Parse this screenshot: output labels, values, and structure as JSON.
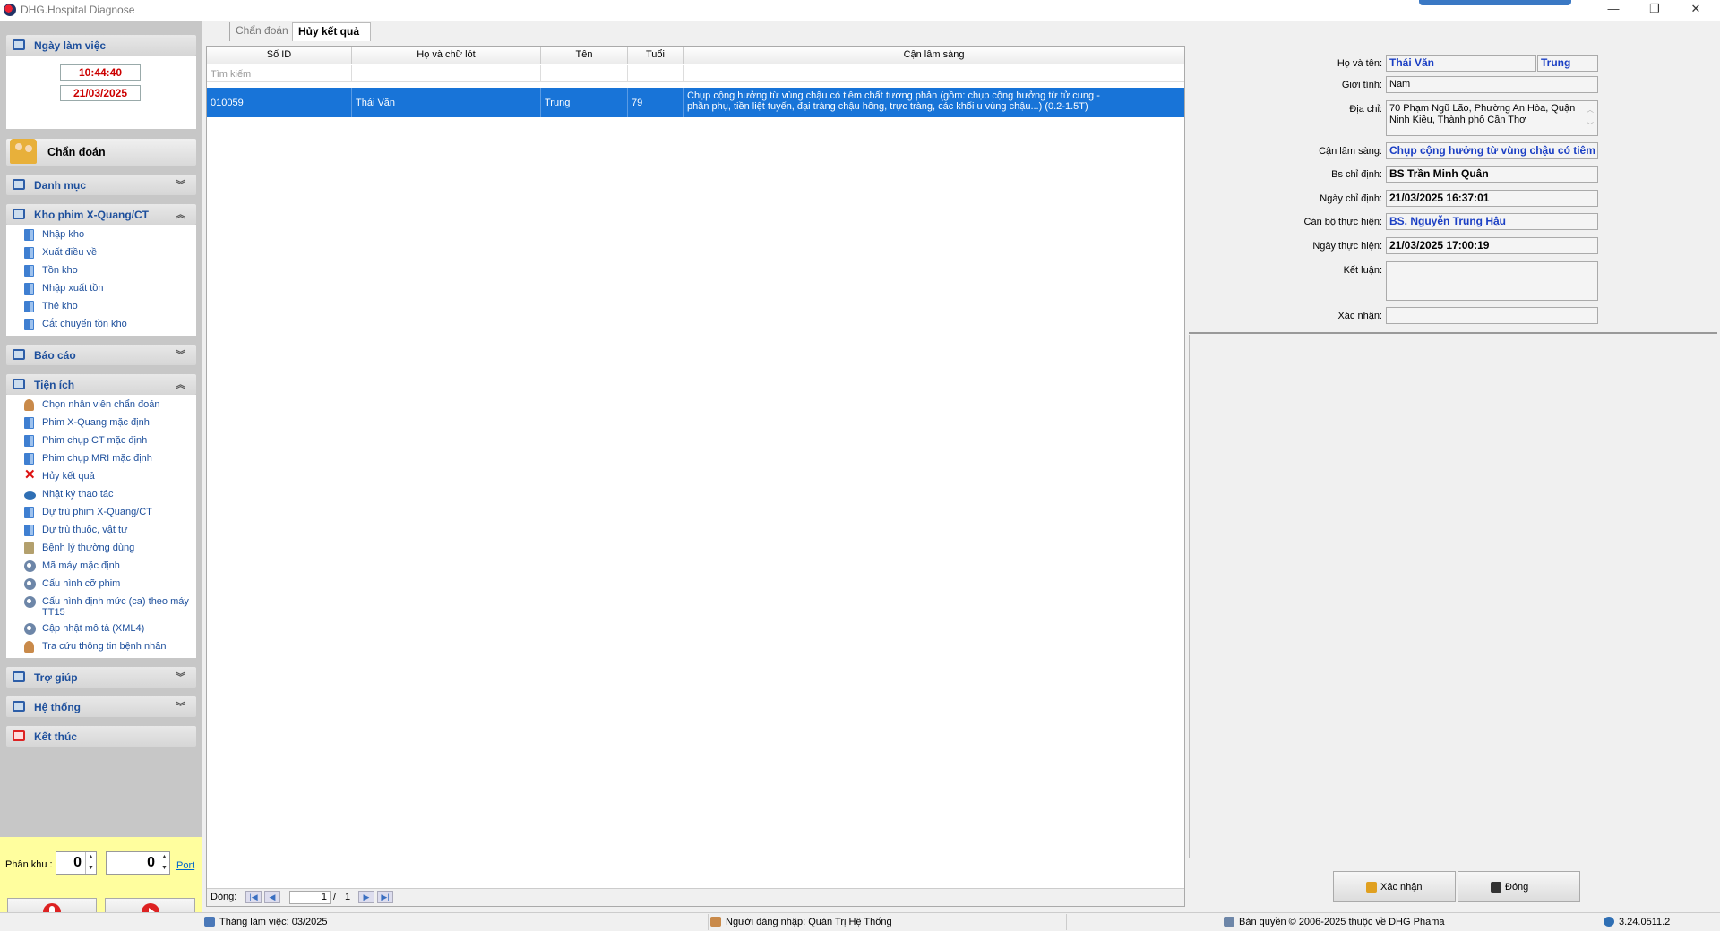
{
  "window": {
    "title": "DHG.Hospital Diagnose"
  },
  "sidebar": {
    "workday_header": "Ngày làm việc",
    "time": "10:44:40",
    "date": "21/03/2025",
    "chandoan_label": "Chẩn đoán",
    "danhmuc_header": "Danh mục",
    "kho_header": "Kho phim X-Quang/CT",
    "kho_items": [
      "Nhập kho",
      "Xuất điều về",
      "Tồn kho",
      "Nhập xuất tồn",
      "Thẻ kho",
      "Cắt chuyển tồn kho"
    ],
    "baocao_header": "Báo cáo",
    "tienich_header": "Tiện ích",
    "tienich_items": [
      "Chọn nhân viên chẩn đoán",
      "Phim X-Quang mặc định",
      "Phim chụp CT mặc định",
      "Phim chụp MRI mặc định",
      "Hủy kết quả",
      "Nhật ký thao tác",
      "Dự trù phim X-Quang/CT",
      "Dự trù thuốc, vật tư",
      "Bệnh lý thường dùng",
      "Mã máy mặc định",
      "Cấu hình cỡ phim",
      "Cấu hình định mức (ca) theo máy TT15",
      "Cập nhật mô tả (XML4)",
      "Tra cứu thông tin bệnh nhân"
    ],
    "trogiup_header": "Trợ giúp",
    "hethong_header": "Hệ thống",
    "ketthuc_header": "Kết thúc",
    "phankhu_label": "Phân khu :",
    "phankhu_value": "0",
    "port_value": "0",
    "port_label": "Port"
  },
  "tabs": {
    "inactive": "Chẩn đoán",
    "active": "Hủy kết quả"
  },
  "grid": {
    "columns": [
      "Số ID",
      "Họ và chữ lót",
      "Tên",
      "Tuổi",
      "Cận lâm sàng"
    ],
    "search_placeholder": "Tìm kiếm",
    "rows": [
      {
        "id": "010059",
        "ho": "Thái Văn",
        "ten": "Trung",
        "tuoi": "79",
        "cls": "Chụp cộng hưởng từ vùng chậu có tiêm chất tương phản (gồm: chụp cộng hưởng từ tử cung - phần phụ, tiền liệt tuyến, đại tràng chậu hông, trực tràng, các khối u vùng chậu...) (0.2-1.5T)"
      }
    ],
    "footer_label": "Dòng:",
    "page_current": "1",
    "page_sep": "/",
    "page_total": "1"
  },
  "detail": {
    "hoten_label": "Họ và tên:",
    "ho_value": "Thái Văn",
    "ten_value": "Trung",
    "gioitinh_label": "Giới tính:",
    "gioitinh_value": "Nam",
    "diachi_label": "Địa chỉ:",
    "diachi_value": "70 Phạm Ngũ Lão, Phường An Hòa, Quận Ninh Kiều, Thành phố Cần Thơ",
    "cls_label": "Cận lâm sàng:",
    "cls_value": "Chụp cộng hưởng từ vùng chậu có tiêm chất tương phản",
    "bschidinh_label": "Bs chỉ định:",
    "bschidinh_value": "BS Trần Minh Quân",
    "ngaychidinh_label": "Ngày chỉ định:",
    "ngaychidinh_value": "21/03/2025  16:37:01",
    "canbo_label": "Cán bộ thực hiện:",
    "canbo_value": "BS. Nguyễn Trung Hậu",
    "ngaythuchien_label": "Ngày thực hiện:",
    "ngaythuchien_value": "21/03/2025  17:00:19",
    "ketluan_label": "Kết luận:",
    "ketluan_value": "",
    "xacnhan_label": "Xác nhận:",
    "xacnhan_value": ""
  },
  "buttons": {
    "confirm": "Xác nhận",
    "close": "Đóng"
  },
  "status": {
    "month": "Tháng làm việc: 03/2025",
    "user": "Người đăng nhập: Quản Trị Hệ Thống",
    "copyright": "Bản quyền © 2006-2025 thuộc về DHG Phama",
    "version": "3.24.0511.2"
  },
  "colors": {
    "selection": "#1874d8",
    "link_blue": "#1d4f9c",
    "date_red": "#cc0000",
    "footer_yellow": "#fffe9e"
  }
}
